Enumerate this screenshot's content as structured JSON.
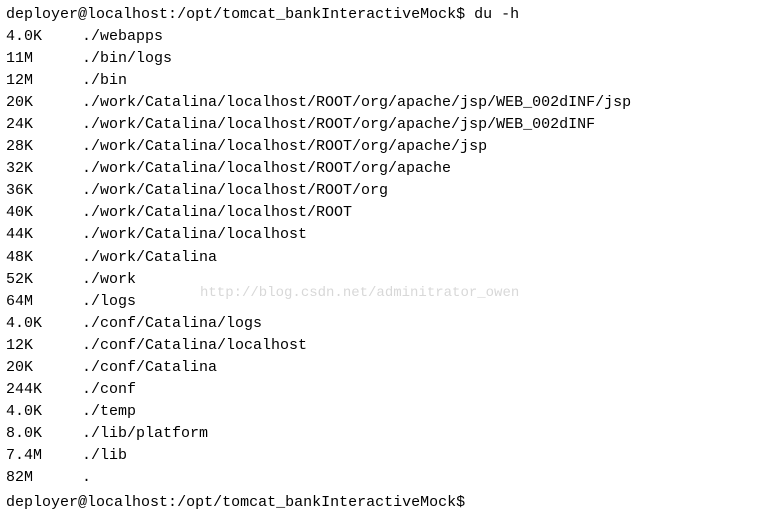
{
  "prompt": {
    "user": "deployer",
    "host": "localhost",
    "path": "/opt/tomcat_bankInteractiveMock",
    "symbol": "$"
  },
  "command": "du -h",
  "output": [
    {
      "size": "4.0K",
      "path": "./webapps"
    },
    {
      "size": "11M",
      "path": "./bin/logs"
    },
    {
      "size": "12M",
      "path": "./bin"
    },
    {
      "size": "20K",
      "path": "./work/Catalina/localhost/ROOT/org/apache/jsp/WEB_002dINF/jsp"
    },
    {
      "size": "24K",
      "path": "./work/Catalina/localhost/ROOT/org/apache/jsp/WEB_002dINF"
    },
    {
      "size": "28K",
      "path": "./work/Catalina/localhost/ROOT/org/apache/jsp"
    },
    {
      "size": "32K",
      "path": "./work/Catalina/localhost/ROOT/org/apache"
    },
    {
      "size": "36K",
      "path": "./work/Catalina/localhost/ROOT/org"
    },
    {
      "size": "40K",
      "path": "./work/Catalina/localhost/ROOT"
    },
    {
      "size": "44K",
      "path": "./work/Catalina/localhost"
    },
    {
      "size": "48K",
      "path": "./work/Catalina"
    },
    {
      "size": "52K",
      "path": "./work"
    },
    {
      "size": "64M",
      "path": "./logs"
    },
    {
      "size": "4.0K",
      "path": "./conf/Catalina/logs"
    },
    {
      "size": "12K",
      "path": "./conf/Catalina/localhost"
    },
    {
      "size": "20K",
      "path": "./conf/Catalina"
    },
    {
      "size": "244K",
      "path": "./conf"
    },
    {
      "size": "4.0K",
      "path": "./temp"
    },
    {
      "size": "8.0K",
      "path": "./lib/platform"
    },
    {
      "size": "7.4M",
      "path": "./lib"
    },
    {
      "size": "82M",
      "path": "."
    }
  ],
  "watermark": "http://blog.csdn.net/adminitrator_owen"
}
